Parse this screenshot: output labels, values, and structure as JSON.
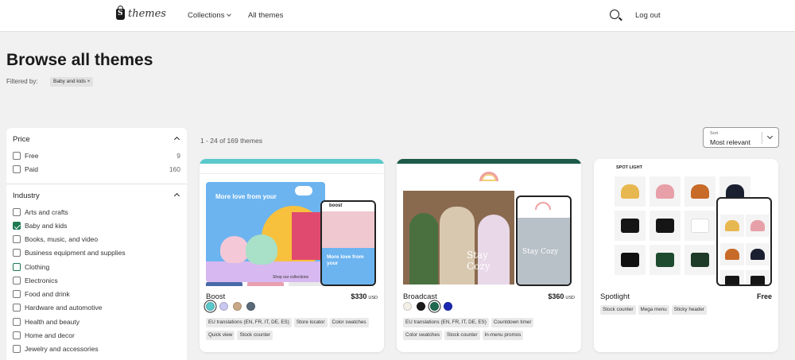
{
  "header": {
    "logo_text": "themes",
    "nav": {
      "collections": "Collections",
      "all_themes": "All themes"
    },
    "logout": "Log out"
  },
  "page": {
    "title": "Browse all themes",
    "filtered_by": "Filtered by:",
    "filter_chip": "Baby and kids ×"
  },
  "sidebar": {
    "price": {
      "title": "Price",
      "options": [
        {
          "label": "Free",
          "count": "9",
          "checked": false
        },
        {
          "label": "Paid",
          "count": "160",
          "checked": false
        }
      ]
    },
    "industry": {
      "title": "Industry",
      "options": [
        {
          "label": "Arts and crafts",
          "checked": false
        },
        {
          "label": "Baby and kids",
          "checked": true
        },
        {
          "label": "Books, music, and video",
          "checked": false
        },
        {
          "label": "Business equipment and supplies",
          "checked": false
        },
        {
          "label": "Clothing",
          "checked": false
        },
        {
          "label": "Electronics",
          "checked": false
        },
        {
          "label": "Food and drink",
          "checked": false
        },
        {
          "label": "Hardware and automotive",
          "checked": false
        },
        {
          "label": "Health and beauty",
          "checked": false
        },
        {
          "label": "Home and decor",
          "checked": false
        },
        {
          "label": "Jewelry and accessories",
          "checked": false
        }
      ]
    }
  },
  "results": {
    "count": "1 - 24 of 169 themes",
    "sort": {
      "label": "Sort",
      "value": "Most relevant"
    }
  },
  "themes": [
    {
      "name": "Boost",
      "price": "$330",
      "currency": "USD",
      "swatches": [
        "#5bc8cc",
        "#c8c8f0",
        "#c8a888",
        "#5a6a7a"
      ],
      "tags": [
        "EU translations (EN, FR, IT, DE, ES)",
        "Store locator",
        "Color swatches",
        "Quick view",
        "Stock counter"
      ],
      "preview": {
        "hero_text": "More love from your",
        "phone_logo": "boost",
        "phone_text": "More love from your",
        "collections_link": "Shop our collections"
      }
    },
    {
      "name": "Broadcast",
      "price": "$360",
      "currency": "USD",
      "swatches": [
        "#f4f0e8",
        "#1a1a1a",
        "#1e6a50",
        "#1a2ab0"
      ],
      "tags": [
        "EU translations (EN, FR, IT, DE, ES)",
        "Countdown timer",
        "Color swatches",
        "Stock counter",
        "In-menu promos"
      ],
      "preview": {
        "hero_text": "Stay Cozy",
        "phone_text": "Stay Cozy"
      }
    },
    {
      "name": "Spotlight",
      "price": "Free",
      "currency": "",
      "swatches": [],
      "tags": [
        "Stock counter",
        "Mega menu",
        "Sticky header"
      ],
      "preview": {
        "logo": "SPOT LIGHT"
      }
    }
  ]
}
